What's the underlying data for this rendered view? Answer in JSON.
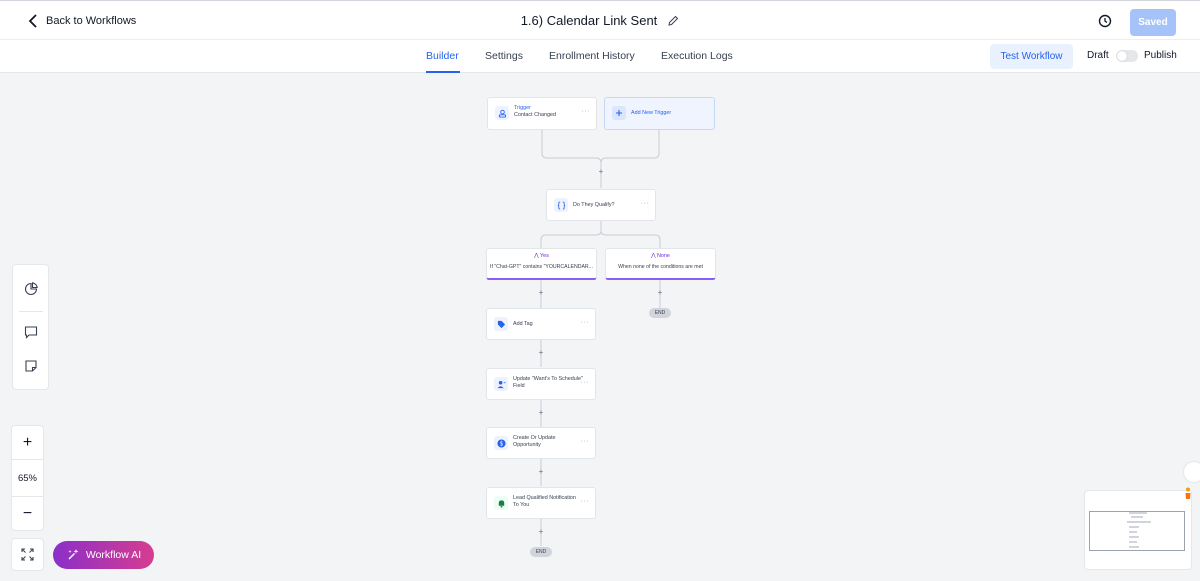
{
  "header": {
    "back_label": "Back to Workflows",
    "title": "1.6) Calendar Link Sent",
    "saved_label": "Saved"
  },
  "tabs": [
    {
      "label": "Builder",
      "active": true
    },
    {
      "label": "Settings",
      "active": false
    },
    {
      "label": "Enrollment History",
      "active": false
    },
    {
      "label": "Execution Logs",
      "active": false
    }
  ],
  "actions": {
    "test_label": "Test Workflow",
    "draft_label": "Draft",
    "publish_label": "Publish",
    "published": false
  },
  "zoom": {
    "level": "65%"
  },
  "ai_button": {
    "label": "Workflow AI"
  },
  "workflow": {
    "trigger": {
      "label": "Trigger",
      "name": "Contact Changed"
    },
    "add_trigger": {
      "label": "Add New Trigger"
    },
    "condition": {
      "label": "Do They Qualify?"
    },
    "branches": [
      {
        "name": "Yes",
        "condition": "If \"Chat-GPT\" contains \"YOURCALENDAR..."
      },
      {
        "name": "None",
        "condition": "When none of the conditions are met"
      }
    ],
    "actions": [
      {
        "label": "Add Tag",
        "icon": "tag-icon"
      },
      {
        "label": "Update \"Want's To Schedule\"",
        "label2": "Field",
        "icon": "user-update-icon"
      },
      {
        "label": "Create Or Update",
        "label2": "Opportunity",
        "icon": "dollar-icon"
      },
      {
        "label": "Lead Qualified Notification",
        "label2": "To You",
        "icon": "bell-icon"
      }
    ],
    "end_label": "END"
  },
  "colors": {
    "accent": "#2563eb",
    "saved_bg": "#a5c3f8",
    "branch_accent": "#8b5cf6",
    "ai_gradient_start": "#8b2fc9",
    "ai_gradient_end": "#d63d8f"
  }
}
